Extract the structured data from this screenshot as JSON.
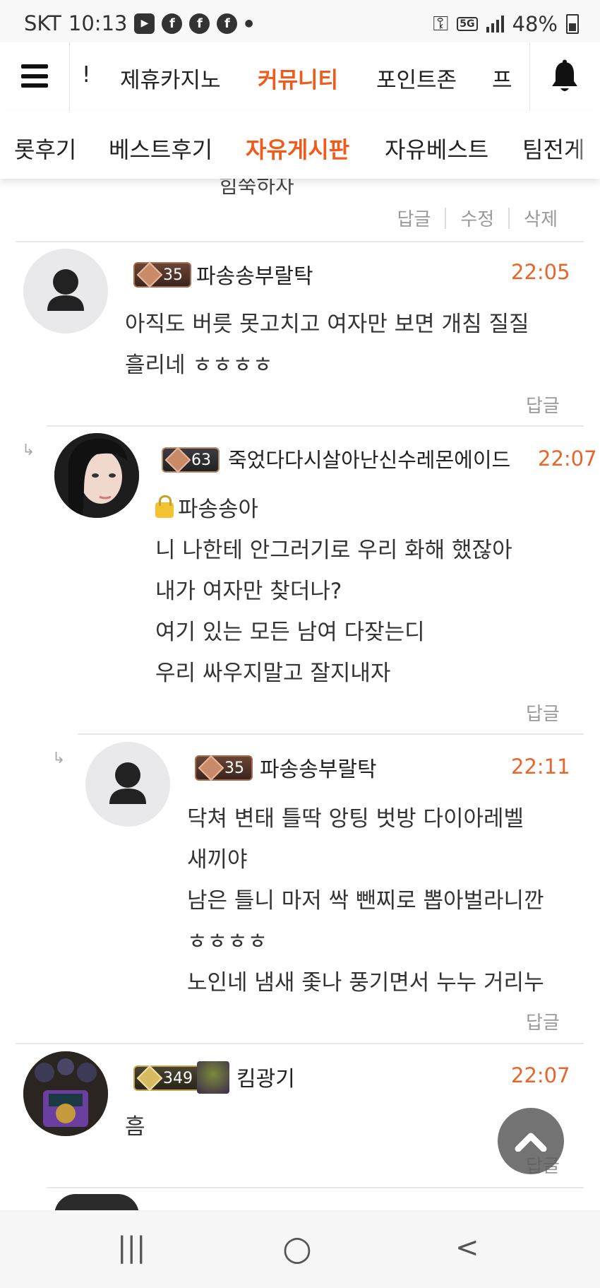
{
  "status_bar": {
    "carrier": "SKT",
    "time": "10:13",
    "network": "5G",
    "battery": "48%"
  },
  "top_nav": {
    "items": [
      {
        "label": "!"
      },
      {
        "label": "제휴카지노"
      },
      {
        "label": "커뮤니티",
        "active": true
      },
      {
        "label": "포인트존"
      },
      {
        "label": "프"
      }
    ]
  },
  "sub_nav": {
    "items": [
      {
        "label": "롯후기"
      },
      {
        "label": "베스트후기"
      },
      {
        "label": "자유게시판",
        "active": true
      },
      {
        "label": "자유베스트"
      },
      {
        "label": "팀전게"
      }
    ]
  },
  "prev_comment": {
    "partial_text": "힘쭉하자",
    "actions": [
      "답글",
      "수정",
      "삭제"
    ]
  },
  "comments": [
    {
      "level": "35",
      "nickname": "파송송부랄탁",
      "time": "22:05",
      "lines": [
        "아직도 버릇 못고치고 여자만 보면 개침 질질",
        "흘리네 ㅎㅎㅎㅎ"
      ],
      "reply_label": "답글"
    },
    {
      "level": "63",
      "nickname": "죽었다다시살아난신수레몬에이드",
      "time": "22:07",
      "mention": "파송송아",
      "lines": [
        "니 나한테  안그러기로 우리 화해 했잖아",
        "내가 여자만 찾더나?",
        "여기 있는 모든 남여 다잦는디",
        "우리 싸우지말고 잘지내자"
      ],
      "reply_label": "답글"
    },
    {
      "level": "35",
      "nickname": "파송송부랄탁",
      "time": "22:11",
      "lines": [
        "닥쳐 변태 틀딱 앙팅 벗방 다이아레벨",
        "새끼야",
        "남은 틀니 마저 싹 뺀찌로 뽑아벌라니깐",
        "ㅎㅎㅎㅎ",
        "노인네 냄새 좇나 풍기면서 누누 거리누"
      ],
      "reply_label": "답글"
    },
    {
      "level": "349",
      "nickname": "킴광기",
      "time": "22:07",
      "lines": [
        "흠"
      ],
      "reply_label": "답글"
    }
  ],
  "icons": {
    "reply_arrow": "↳",
    "menu": "hamburger-icon",
    "bell": "bell-icon",
    "scroll_top": "chevron-up-icon"
  },
  "colors": {
    "accent": "#f05a1a",
    "time": "#e8652b"
  },
  "bottom_nav": {
    "recent": "|||",
    "home": "○",
    "back": "<"
  }
}
